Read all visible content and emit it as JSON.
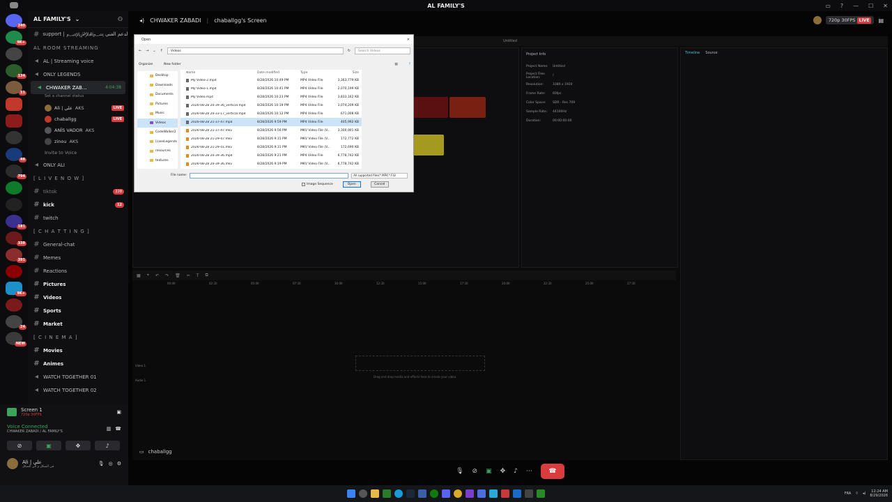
{
  "window": {
    "title": "AL FAMILY'S"
  },
  "server": {
    "name": "AL FAMILY'S"
  },
  "servers": [
    {
      "color": "#2b6cd1",
      "badge": "240"
    },
    {
      "color": "#1f8a4c",
      "badge": "9K+"
    },
    {
      "color": "#444",
      "badge": ""
    },
    {
      "color": "#2a5d2a",
      "badge": "134"
    },
    {
      "color": "#7a5b3c",
      "badge": "11"
    },
    {
      "color": "#c0392b",
      "badge": ""
    },
    {
      "color": "#8e1b1b",
      "badge": ""
    },
    {
      "color": "#333",
      "badge": ""
    },
    {
      "color": "#1a3b7a",
      "badge": "48"
    },
    {
      "color": "#2c2c2c",
      "badge": "794"
    },
    {
      "color": "#0f7a2a",
      "badge": ""
    },
    {
      "color": "#222",
      "badge": ""
    },
    {
      "color": "#3b2f8f",
      "badge": "181"
    },
    {
      "color": "#6b1a1a",
      "badge": "338"
    },
    {
      "color": "#8b2d2d",
      "badge": "391"
    },
    {
      "color": "#8b0000",
      "badge": ""
    },
    {
      "color": "#1e90c8",
      "badge": "9K+"
    },
    {
      "color": "#7a1a1a",
      "badge": ""
    },
    {
      "color": "#444",
      "badge": "24"
    },
    {
      "color": "#3a3a3a",
      "badge": "NEW"
    }
  ],
  "channels": {
    "support": "support | ﷽ الدعم الفني",
    "vc_cat": "AL ROOM STREAMING",
    "streaming_voice": "AL | Streaming voice",
    "only_legends": "ONLY LEGENDS",
    "chwaker": "CHWAKER ZAB...",
    "chwaker_time": "4:04:38",
    "channel_status": "Set a channel status",
    "users": [
      {
        "name": "Ali | علي",
        "tag": "AKS",
        "live": "LIVE",
        "color": "#8a6d3b"
      },
      {
        "name": "chaballgg",
        "tag": "",
        "live": "LIVE",
        "color": "#c0392b"
      },
      {
        "name": "ANÏS VADOR",
        "tag": "AKS",
        "live": "",
        "color": "#555"
      },
      {
        "name": "zinou",
        "tag": "AKS",
        "live": "",
        "color": "#444"
      }
    ],
    "invite": "Invite to Voice",
    "only_ali": "ONLY ALI",
    "live_cat": "[ L I V E N O W ]",
    "tiktok": "tiktok",
    "tiktok_count": "228",
    "kick": "kick",
    "kick_count": "12",
    "twitch": "twitch",
    "chat_cat": "[ C H A T T I N G ]",
    "general": "General-chat",
    "memes": "Memes",
    "reactions": "Reactions",
    "pictures": "Pictures",
    "videos": "Videos",
    "sports": "Sports",
    "market": "Market",
    "cinema_cat": "[ C I N E M A ]",
    "movies": "Movies",
    "animes": "Animes",
    "watch1": "WATCH TOGETHER 01",
    "watch2": "WATCH TOGETHER 02"
  },
  "bottom": {
    "screen": "Screen 1",
    "screen_sub": "720p 30FPS",
    "voice_connected": "Voice Connected",
    "voice_sub": "CHWAKER ZABADI / AL FAMILY'S",
    "user": "Ali | علي",
    "user_sub": "في الشكل و الي الشكل"
  },
  "header": {
    "channel": "CHWAKER ZABADI",
    "screen_title": "chaballgg's Screen",
    "quality": "720p 30FPS",
    "live": "LIVE"
  },
  "editor": {
    "untitled": "Untitled",
    "project_info": "Project Info",
    "timeline": "Timeline",
    "source": "Source",
    "drag_hint": "Drag and drop media and effects here to create your video.",
    "video1": "Video 1",
    "audio1": "Audio 1",
    "info": [
      {
        "k": "Project Name:",
        "v": "Untitled"
      },
      {
        "k": "Project Files Location:",
        "v": "/"
      },
      {
        "k": "Resolution:",
        "v": "1080 x 1920"
      },
      {
        "k": "Frame Rate:",
        "v": "60fps"
      },
      {
        "k": "Color Space:",
        "v": "SDR - Rec.709"
      },
      {
        "k": "Sample Rate:",
        "v": "44100Hz"
      },
      {
        "k": "Duration:",
        "v": "00:00:00:00"
      }
    ],
    "ruler": [
      "00:00",
      "02:30",
      "05:00",
      "07:30",
      "10:00",
      "12:30",
      "15:00",
      "17:30",
      "20:00",
      "22:30",
      "25:00",
      "27:30"
    ]
  },
  "dialog": {
    "title": "Open",
    "path": "Videos",
    "search": "Search Videos",
    "organize": "Organize",
    "new_folder": "New folder",
    "nav": [
      "Desktop",
      "Downloads",
      "Documents",
      "Pictures",
      "Music",
      "Videos",
      "CodeWalker2",
      "[caseLegends",
      "resources",
      "textures"
    ],
    "cols": [
      "Name",
      "Date modified",
      "Type",
      "Size"
    ],
    "files": [
      {
        "n": "My Video-2.mp4",
        "d": "8/28/2026 10:49 PM",
        "t": "MP4 Video File",
        "s": "3,363,779 KB"
      },
      {
        "n": "My Video-1.mp4",
        "d": "8/28/2026 10:41 PM",
        "t": "MP4 Video File",
        "s": "2,070,199 KB"
      },
      {
        "n": "My Video.mp4",
        "d": "8/28/2026 10:23 PM",
        "t": "MP4 Video File",
        "s": "3,833,162 KB"
      },
      {
        "n": "2026-08-28 20-39-36_vertical.mp4",
        "d": "8/28/2026 10:19 PM",
        "t": "MP4 Video File",
        "s": "3,074,209 KB"
      },
      {
        "n": "2026-08-28 20-33-17_vertical.mp4",
        "d": "8/28/2026 10:12 PM",
        "t": "MP4 Video File",
        "s": "671,008 KB"
      },
      {
        "n": "2026-08-28 21-37-47.mp4",
        "d": "8/28/2026 9:59 PM",
        "t": "MP4 Video File",
        "s": "405,992 KB"
      },
      {
        "n": "2026-08-28 21-37-47.mkv",
        "d": "8/28/2026 9:56 PM",
        "t": "MKV Video File (V...",
        "s": "3,300,901 KB"
      },
      {
        "n": "2026-08-28 21-29-47.mkv",
        "d": "8/28/2026 9:31 PM",
        "t": "MKV Video File (V...",
        "s": "172,772 KB"
      },
      {
        "n": "2026-08-28 21-29-41.mkv",
        "d": "8/28/2026 9:31 PM",
        "t": "MKV Video File (V...",
        "s": "172,690 KB"
      },
      {
        "n": "2026-08-28 20-39-36.mp4",
        "d": "8/28/2026 9:21 PM",
        "t": "MP4 Video File",
        "s": "6,778,742 KB"
      },
      {
        "n": "2026-08-28 20-39-36.mkv",
        "d": "8/28/2026 9:19 PM",
        "t": "MKV Video File (V...",
        "s": "6,778,742 KB"
      }
    ],
    "file_name_label": "File name:",
    "filter": "All supported files(*.MP4;*.FLV",
    "image_seq": "Image Sequence",
    "open": "Open",
    "cancel": "Cancel"
  },
  "streamer_tab": "chaballgg",
  "clock": {
    "time": "12:24 AM",
    "date": "8/29/2026",
    "lang": "FRA"
  },
  "colors": {
    "live": "#d83c3e",
    "green": "#3ba55d",
    "accent": "#5865f2"
  }
}
